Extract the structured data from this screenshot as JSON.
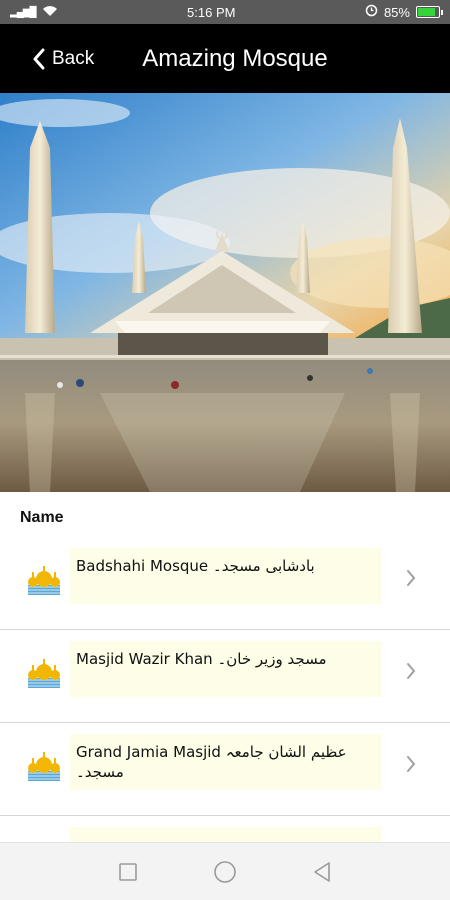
{
  "status_bar": {
    "signal": "▐▌▐▌",
    "time": "5:16 PM",
    "battery": "85%",
    "battery_level": 0.85,
    "battery_color": "#35d43a"
  },
  "header": {
    "back_label": "Back",
    "title": "Amazing Mosque",
    "background": "#000000"
  },
  "hero_image": {
    "description_icon": "mosque-photo"
  },
  "list": {
    "section_title": "Name",
    "items": [
      {
        "label": "Badshahi Mosque بادشابی مسجد۔"
      },
      {
        "label": "Masjid Wazir Khan مسجد وزیر خان۔"
      },
      {
        "label": "Grand Jamia Masjid عظیم الشان جامعہ مسجد۔"
      },
      {
        "label": ""
      }
    ]
  },
  "nav": {
    "icons": [
      "square-icon",
      "circle-icon",
      "triangle-back-icon"
    ]
  }
}
